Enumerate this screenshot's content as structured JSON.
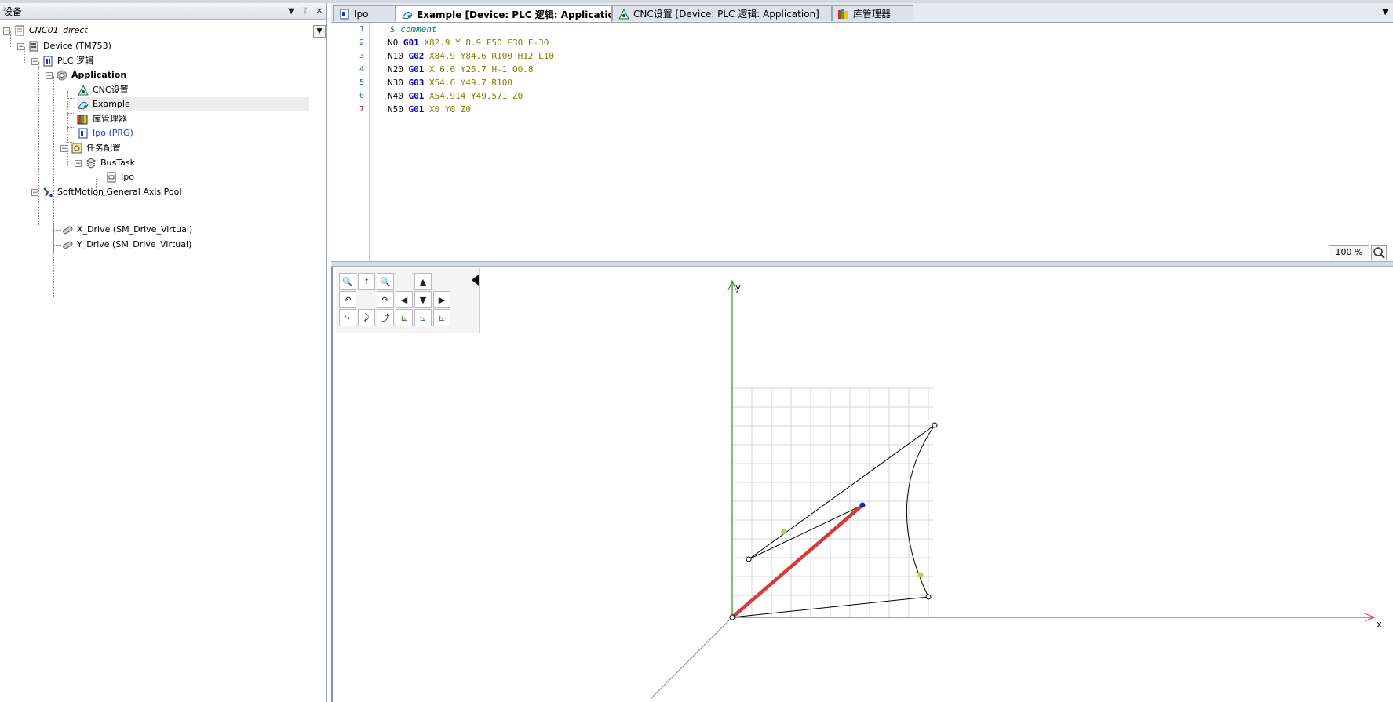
{
  "device_panel": {
    "title": "设备",
    "tree": {
      "root": "CNC01_direct",
      "device": "Device (TM753)",
      "plc": "PLC 逻辑",
      "application": "Application",
      "cnc_settings": "CNC设置",
      "example": "Example",
      "library_manager": "库管理器",
      "ipo_prg": "Ipo (PRG)",
      "task_config": "任务配置",
      "bustask": "BusTask",
      "ipo_task": "Ipo",
      "axis_pool": "SoftMotion General Axis Pool",
      "x_drive": "X_Drive (SM_Drive_Virtual)",
      "y_drive": "Y_Drive (SM_Drive_Virtual)"
    }
  },
  "tabs": [
    {
      "label": "Ipo"
    },
    {
      "label": "Example [Device: PLC 逻辑: Application]"
    },
    {
      "label": "CNC设置 [Device: PLC 逻辑: Application]"
    },
    {
      "label": "库管理器"
    }
  ],
  "code": {
    "line_numbers": [
      "1",
      "2",
      "3",
      "4",
      "5",
      "6",
      "7"
    ],
    "comment": "$ comment",
    "lines": [
      {
        "n": "N0",
        "g": "G01",
        "rest": " X82.9 Y 8.9 F50 E30 E-30"
      },
      {
        "n": "N10",
        "g": "G02",
        "rest": " X84.9 Y84.6 R100 H12 L10"
      },
      {
        "n": "N20",
        "g": "G01",
        "rest": " X 6.6 Y25.7 H-1 O0.8"
      },
      {
        "n": "N30",
        "g": "G03",
        "rest": " X54.6 Y49.7 R100"
      },
      {
        "n": "N40",
        "g": "G01",
        "rest": " X54.914 Y49.571 Z0"
      },
      {
        "n": "N50",
        "g": "G01",
        "rest": " X0 Y0 Z0"
      }
    ]
  },
  "zoom_level": "100 %",
  "plot": {
    "x_label": "x",
    "y_label": "y",
    "path_color": "#000000",
    "current_segment_color": "#d83a3a",
    "x_axis_color": "#e03c3c",
    "y_axis_color": "#2a9a2a",
    "marker_color": "#a4e04a",
    "current_point_color": "#1a2ab0"
  },
  "toolbox_icons": [
    "zoom-in-icon",
    "pan-up-icon",
    "zoom-out-icon",
    "home-top-icon",
    "rotate-left-icon",
    "rotate-right-icon",
    "step-back-icon",
    "step-down-icon",
    "step-forward-icon",
    "path-left-icon",
    "path-mid-icon",
    "path-right-icon",
    "axis-xy-icon",
    "axis-xz-icon",
    "axis-yz-icon"
  ]
}
